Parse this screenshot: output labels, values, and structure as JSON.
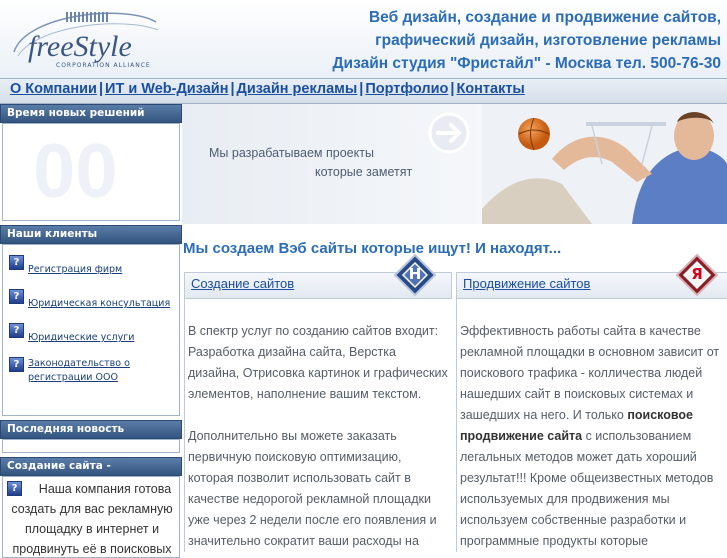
{
  "header": {
    "logo_text": "freeStyle",
    "logo_sub": "CORPORATION ALLIANCE",
    "tagline": [
      "Веб дизайн, создание и продвижение сайтов,",
      "графический дизайн, изготовление рекламы",
      "Дизайн студия \"Фристайл\" - Москва тел. 500-76-30"
    ]
  },
  "nav": {
    "items": [
      "О Компании",
      "ИТ и Web-Дизайн",
      "Дизайн рекламы",
      "Портфолио",
      "Контакты"
    ],
    "separator": "|"
  },
  "sidebar": {
    "time_title": "Время новых решений",
    "clock_value": "00",
    "clients_title": "Наши клиенты",
    "clients": [
      {
        "label": "Регистрация фирм",
        "label2": ""
      },
      {
        "label": "Юридическая консультация",
        "label2": ""
      },
      {
        "label": "Юридические услуги",
        "label2": ""
      },
      {
        "label": "Законодательство о",
        "label2": "регистрации ООО"
      }
    ],
    "news_title": "Последняя новость",
    "free_title": "Создание сайта - Бесплатно",
    "free_text": "Наша компания готова создать для вас рекламную площадку в интернет и продвинуть её в поисковых"
  },
  "hero": {
    "line1": "Мы разрабатываем проекты",
    "line2": "которые заметят"
  },
  "main": {
    "headline": "Мы создаем Вэб сайты которые ищут! И находят...",
    "col1": {
      "title": "Создание сайтов",
      "icon_letter": "H",
      "p1": "В спектр услуг по созданию сайтов входит: Разработка дизайна сайта, Верстка дизайна, Отрисовка картинок и графических элементов, наполнение вашим текстом.",
      "p2": "Дополнительно вы можете заказать первичную поисковую оптимизацию, которая позволит использовать сайт в качестве недорогой рекламной площадки уже через 2 недели после его появления и значительно сократит ваши расходы на"
    },
    "col2": {
      "title": "Продвижение сайтов",
      "icon_letter": "Я",
      "p1a": "Эффективность работы сайта в качестве рекламной площадки в основном зависит от поискового трафика - колличества людей нашедших сайт в поисковых системах и зашедших на него. И только ",
      "p1b": "поисковое продвижение сайта",
      "p1c": " с использованием легальных методов может дать хороший результат!!! Кроме общеизвестных методов используемых для продвижения мы используем собственные разработки и программные продукты которые"
    }
  },
  "colors": {
    "accent": "#2b6cb8",
    "link": "#1a4fa0",
    "sidebar_title_bg": "#33557f"
  }
}
